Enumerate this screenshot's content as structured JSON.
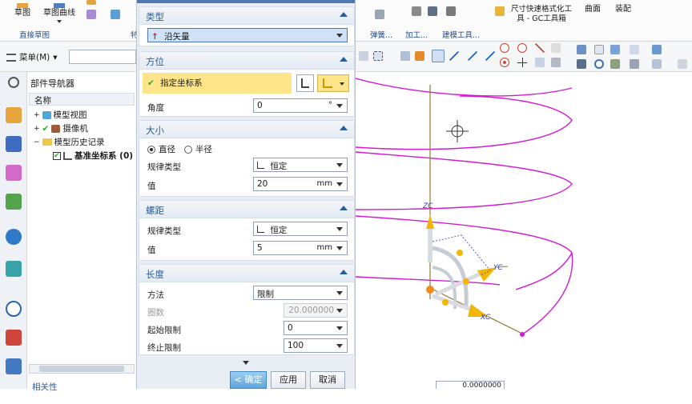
{
  "ribbon": {
    "sketch_label": "草图",
    "sketch_curve_label": "草图曲线",
    "direct_sketch_group": "直接草图",
    "trim_group": "弹簧...",
    "process_group": "加工...",
    "modeling_tools_group": "建模工具...",
    "dim_format_tool": "尺寸快速格式化工具 - GC工具箱",
    "surface_label": "曲面",
    "assembly_label": "装配",
    "partial_text": "特"
  },
  "toolbar": {
    "menu_label": "菜单(M)",
    "menu_arrow": "▾"
  },
  "navigator": {
    "title": "部件导航器",
    "name_col": "名称",
    "items": [
      {
        "label": "模型视图"
      },
      {
        "label": "摄像机"
      },
      {
        "label": "模型历史记录"
      },
      {
        "label": "基准坐标系 (0)"
      }
    ],
    "bottom_label": "相关性"
  },
  "dialog": {
    "type": {
      "header": "类型",
      "value": "沿矢量"
    },
    "orientation": {
      "header": "方位",
      "specify_csys": "指定坐标系",
      "angle_label": "角度",
      "angle_value": "0",
      "angle_unit": "°"
    },
    "size": {
      "header": "大小",
      "diameter": "直径",
      "radius": "半径",
      "law_type_label": "规律类型",
      "law_type_value": "恒定",
      "value_label": "值",
      "value": "20",
      "unit": "mm"
    },
    "pitch": {
      "header": "螺距",
      "law_type_label": "规律类型",
      "law_type_value": "恒定",
      "value_label": "值",
      "value": "5",
      "unit": "mm"
    },
    "length": {
      "header": "长度",
      "method_label": "方法",
      "method_value": "限制",
      "turns_label": "圈数",
      "turns_value": "20.000000",
      "start_label": "起始限制",
      "start_value": "0",
      "end_label": "终止限制",
      "end_value": "100"
    },
    "ok_button": "< 确定 >",
    "apply_button": "应用",
    "cancel_button": "取消"
  },
  "viewport": {
    "axis_z": "ZC",
    "axis_y": "YC",
    "axis_x": "XC",
    "coord_readout": "0.0000000"
  },
  "colors": {
    "helix": "#d21bd2",
    "csys_yellow": "#f2b705",
    "highlight": "#ffe58a",
    "check_green": "#2fa82f"
  }
}
